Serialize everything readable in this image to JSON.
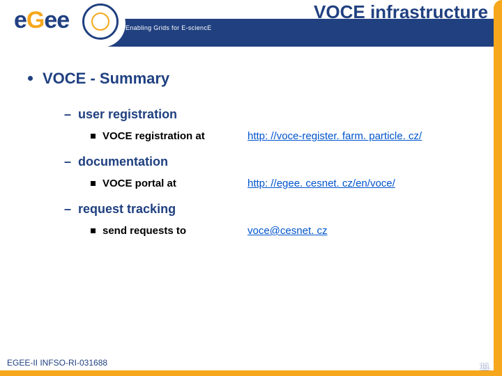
{
  "header": {
    "title": "VOCE infrastructure",
    "tagline": "Enabling Grids for E-sciencE",
    "logo_text_1": "e",
    "logo_text_2": "G",
    "logo_text_3": "ee"
  },
  "content": {
    "heading": "VOCE - Summary",
    "sections": [
      {
        "label": "user registration",
        "item_label": "VOCE registration at",
        "item_link": "http: //voce-register. farm. particle. cz/"
      },
      {
        "label": "documentation",
        "item_label": "VOCE portal at",
        "item_link": "http: //egee. cesnet. cz/en/voce/"
      },
      {
        "label": "request tracking",
        "item_label": "send requests to",
        "item_link": "voce@cesnet. cz"
      }
    ]
  },
  "footer": {
    "ref": "EGEE-II INFSO-RI-031688",
    "page": "11"
  }
}
